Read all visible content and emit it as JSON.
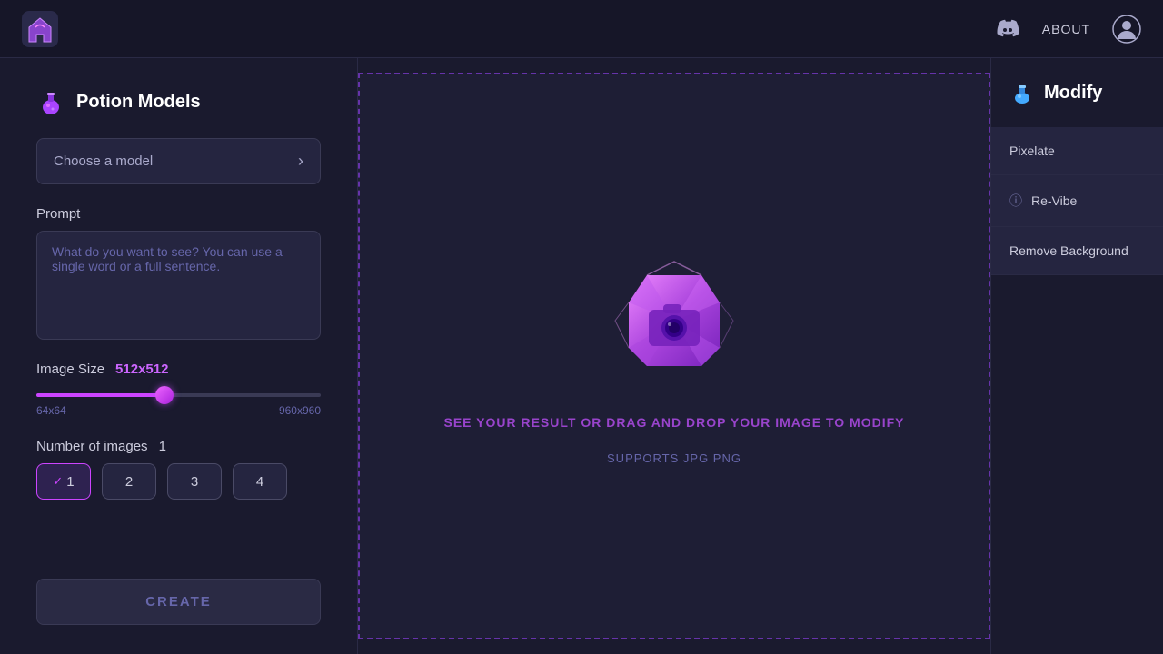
{
  "header": {
    "logo_alt": "Potion Models Logo",
    "about_label": "ABOUT",
    "discord_icon": "discord",
    "user_icon": "user-circle"
  },
  "left_panel": {
    "section_title": "Potion Models",
    "model_selector": {
      "placeholder": "Choose a model",
      "chevron": "›"
    },
    "prompt": {
      "label": "Prompt",
      "placeholder": "What do you want to see? You can use a single word or a full sentence."
    },
    "image_size": {
      "label": "Image Size",
      "value": "512x512",
      "min_label": "64x64",
      "max_label": "960x960",
      "slider_percent": 45
    },
    "num_images": {
      "label": "Number of images",
      "value": "1",
      "options": [
        "1",
        "2",
        "3",
        "4"
      ],
      "selected": "1"
    },
    "create_button": "CREATE"
  },
  "center_panel": {
    "drop_text_primary": "SEE YOUR RESULT OR DRAG AND DROP YOUR IMAGE TO MODIFY",
    "drop_text_secondary": "SUPPORTS JPG PNG"
  },
  "right_panel": {
    "title": "Modify",
    "options": [
      {
        "label": "Pixelate",
        "has_info": false
      },
      {
        "label": "Re-Vibe",
        "has_info": true
      },
      {
        "label": "Remove Background",
        "has_info": false
      }
    ]
  }
}
